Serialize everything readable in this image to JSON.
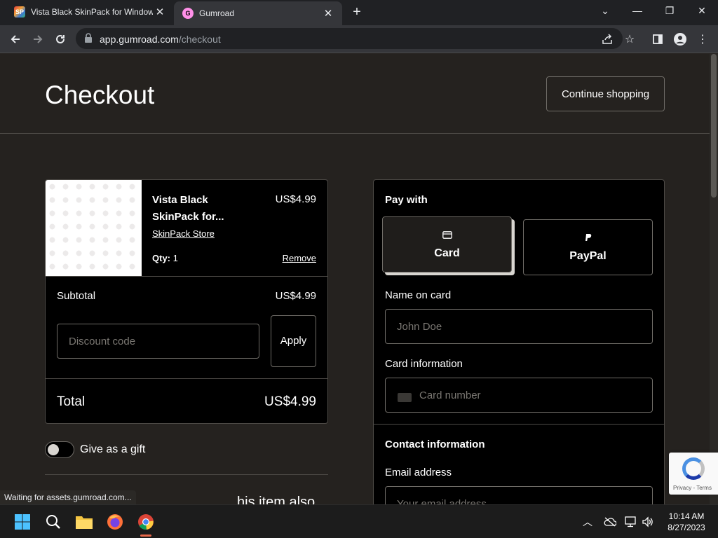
{
  "browser": {
    "tabs": [
      {
        "title": "Vista Black SkinPack for Windows",
        "favicon": "skinpack-favicon",
        "active": false
      },
      {
        "title": "Gumroad",
        "favicon": "gumroad-favicon",
        "active": true
      }
    ],
    "address": {
      "domain": "app.gumroad.com",
      "path": "/checkout"
    }
  },
  "page": {
    "title": "Checkout",
    "continue_label": "Continue shopping"
  },
  "cart": {
    "item": {
      "name": "Vista Black SkinPack for...",
      "price": "US$4.99",
      "store": "SkinPack Store",
      "qty_label": "Qty:",
      "qty": "1",
      "remove_label": "Remove"
    },
    "subtotal_label": "Subtotal",
    "subtotal": "US$4.99",
    "discount_placeholder": "Discount code",
    "apply_label": "Apply",
    "total_label": "Total",
    "total": "US$4.99"
  },
  "gift": {
    "label": "Give as a gift",
    "enabled": false
  },
  "also_text": "his item also",
  "payment": {
    "heading": "Pay with",
    "options": [
      {
        "label": "Card",
        "icon": "card-icon",
        "selected": true
      },
      {
        "label": "PayPal",
        "icon": "paypal-icon",
        "selected": false
      }
    ],
    "name_label": "Name on card",
    "name_placeholder": "John Doe",
    "card_label": "Card information",
    "card_placeholder": "Card number",
    "contact_heading": "Contact information",
    "email_label": "Email address",
    "email_placeholder": "Your email address"
  },
  "recaptcha": {
    "text": "Privacy - Terms"
  },
  "status_text": "Waiting for assets.gumroad.com...",
  "taskbar": {
    "time": "10:14 AM",
    "date": "8/27/2023"
  },
  "colors": {
    "background": "#25221f",
    "panel": "#000000",
    "border": "#4d4a46",
    "accent_gumroad": "#ff90e8"
  }
}
